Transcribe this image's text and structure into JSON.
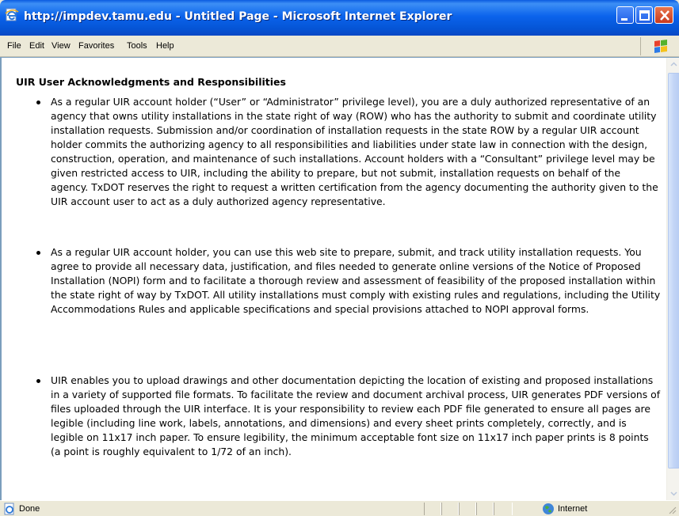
{
  "window": {
    "title": "http://impdev.tamu.edu - Untitled Page - Microsoft Internet Explorer"
  },
  "menu": {
    "file": "File",
    "edit": "Edit",
    "view": "View",
    "favorites": "Favorites",
    "tools": "Tools",
    "help": "Help"
  },
  "page": {
    "heading": "UIR User Acknowledgments and Responsibilities",
    "paragraphs": [
      "As a regular UIR account holder (“User” or “Administrator” privilege level), you are a duly authorized representative of an agency that owns utility installations in the state right of way (ROW) who has the authority to submit and coordinate utility installation requests. Submission and/or coordination of installation requests in the state ROW by a regular UIR account holder commits the authorizing agency to all responsibilities and liabilities under state law in connection with the design, construction, operation, and maintenance of such installations. Account holders with a “Consultant” privilege level may be given restricted access to UIR, including the ability to prepare, but not submit, installation requests on behalf of the agency. TxDOT reserves the right to request a written certification from the agency documenting the authority given to the UIR account user to act as a duly authorized agency representative.",
      "As a regular UIR account holder, you can use this web site to prepare, submit, and track utility installation requests. You agree to provide all necessary data, justification, and files needed to generate online versions of the Notice of Proposed Installation (NOPI) form and to facilitate a thorough review and assessment of feasibility of the proposed installation within the state right of way by TxDOT. All utility installations must comply with existing rules and regulations, including the Utility Accommodations Rules and applicable specifications and special provisions attached to NOPI approval forms.",
      "UIR enables you to upload drawings and other documentation depicting the location of existing and proposed installations in a variety of supported file formats. To facilitate the review and document archival process, UIR generates PDF versions of files uploaded through the UIR interface. It is your responsibility to review each PDF file generated to ensure all pages are legible (including line work, labels, annotations, and dimensions) and every sheet prints completely, correctly, and is legible on 11x17 inch paper. To ensure legibility, the minimum acceptable font size on 11x17 inch paper prints is 8 points (a point is roughly equivalent to 1/72 of an inch)."
    ]
  },
  "status": {
    "text": "Done",
    "zone": "Internet"
  },
  "icons": {
    "title": "ie-page-icon",
    "status": "ie-page-icon",
    "zone": "globe-icon",
    "throbber": "windows-flag-icon"
  },
  "colors": {
    "titlebar": "#0b63ec",
    "chrome": "#ece9d8",
    "close_button": "#c8391d"
  }
}
